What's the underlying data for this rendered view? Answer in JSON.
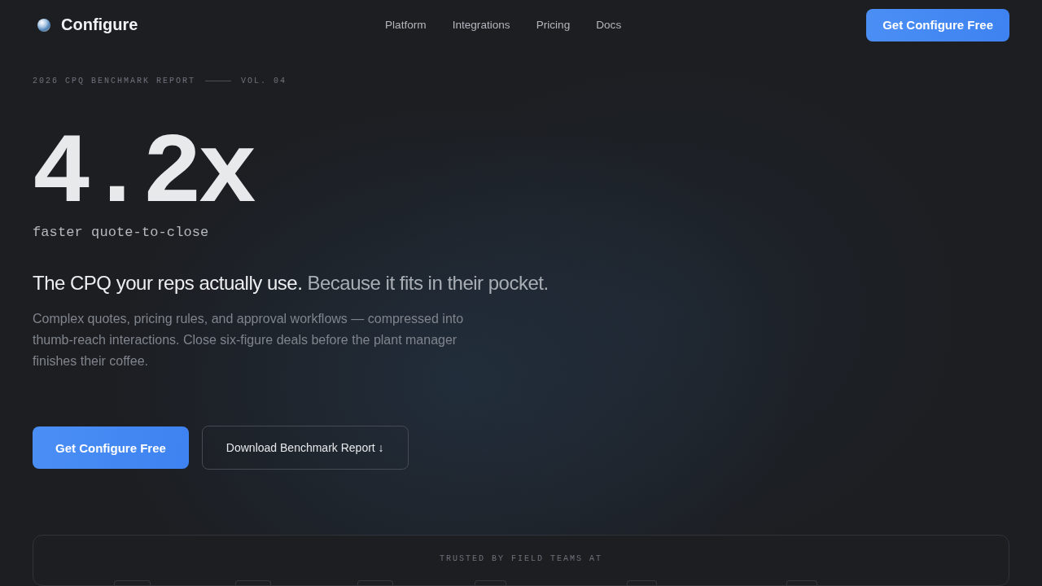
{
  "header": {
    "brand": "Configure",
    "nav": [
      {
        "label": "Platform"
      },
      {
        "label": "Integrations"
      },
      {
        "label": "Pricing"
      },
      {
        "label": "Docs"
      }
    ],
    "cta": "Get Configure Free"
  },
  "hero": {
    "eyebrow": "2026 CPQ BENCHMARK REPORT",
    "volume": "VOL. 04",
    "stat": "4.2x",
    "stat_caption": "faster quote-to-close",
    "headline": {
      "text": "The CPQ your reps actually use.",
      "muted_text": "Because it fits in their pocket."
    },
    "body": "Complex quotes, pricing rules, and approval workflows — compressed into thumb-reach interactions. Close six-figure deals before the plant manager finishes their coffee.",
    "buttons": [
      {
        "label": "Get Configure Free",
        "kind": "primary"
      },
      {
        "label": "Download Benchmark Report ↓",
        "kind": "secondary"
      }
    ]
  },
  "trusted": {
    "title": "TRUSTED BY FIELD TEAMS AT"
  }
}
